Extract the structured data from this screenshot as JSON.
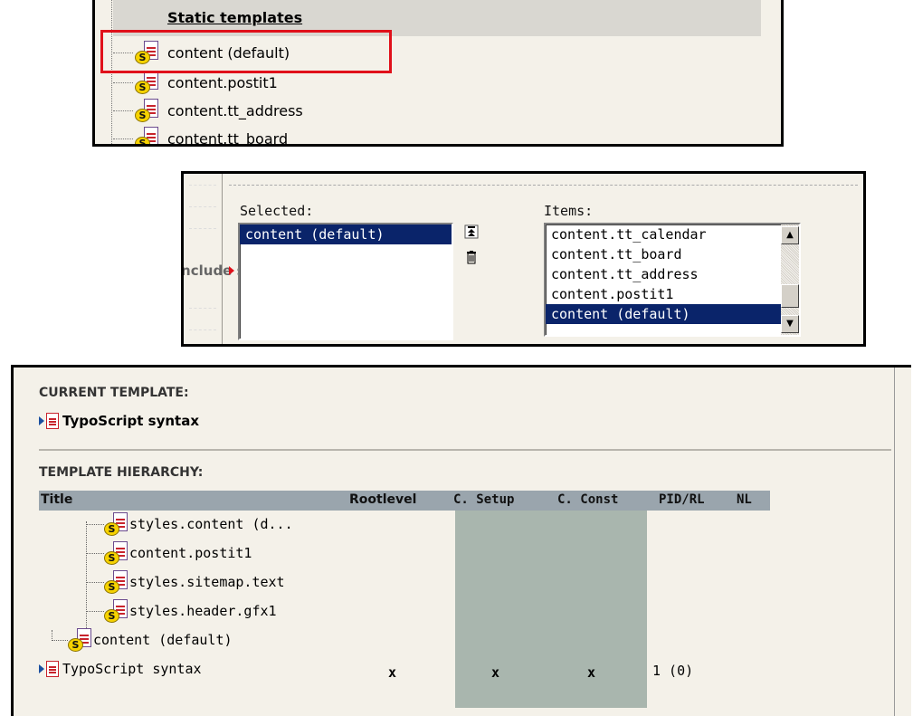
{
  "static_templates": {
    "heading": "Static templates",
    "items": [
      "content (default)",
      "content.postit1",
      "content.tt_address",
      "content.tt_board"
    ]
  },
  "include_static": {
    "label": "Include static:",
    "selected_caption": "Selected:",
    "items_caption": "Items:",
    "selected_items": [
      "content (default)"
    ],
    "available_items": [
      "content.tt_calendar",
      "content.tt_board",
      "content.tt_address",
      "content.postit1",
      "content (default)"
    ],
    "available_selected": "content (default)"
  },
  "current_template": {
    "heading": "CURRENT TEMPLATE:",
    "name": "TypoScript syntax"
  },
  "template_hierarchy": {
    "heading": "TEMPLATE HIERARCHY:",
    "columns": [
      "Title",
      "Rootlevel",
      "C. Setup",
      "C. Const",
      "PID/RL",
      "NL"
    ],
    "rows": [
      {
        "title": "styles.content (d..."
      },
      {
        "title": "content.postit1"
      },
      {
        "title": "styles.sitemap.text"
      },
      {
        "title": "styles.header.gfx1"
      },
      {
        "title": "content (default)"
      },
      {
        "title": "TypoScript syntax",
        "rootlevel": "x",
        "setup": "x",
        "const": "x",
        "pid": "1 (0)"
      }
    ]
  },
  "colors": {
    "highlight": "#e0101a",
    "selection": "#0a246a",
    "table_header": "#9aa5ad"
  }
}
